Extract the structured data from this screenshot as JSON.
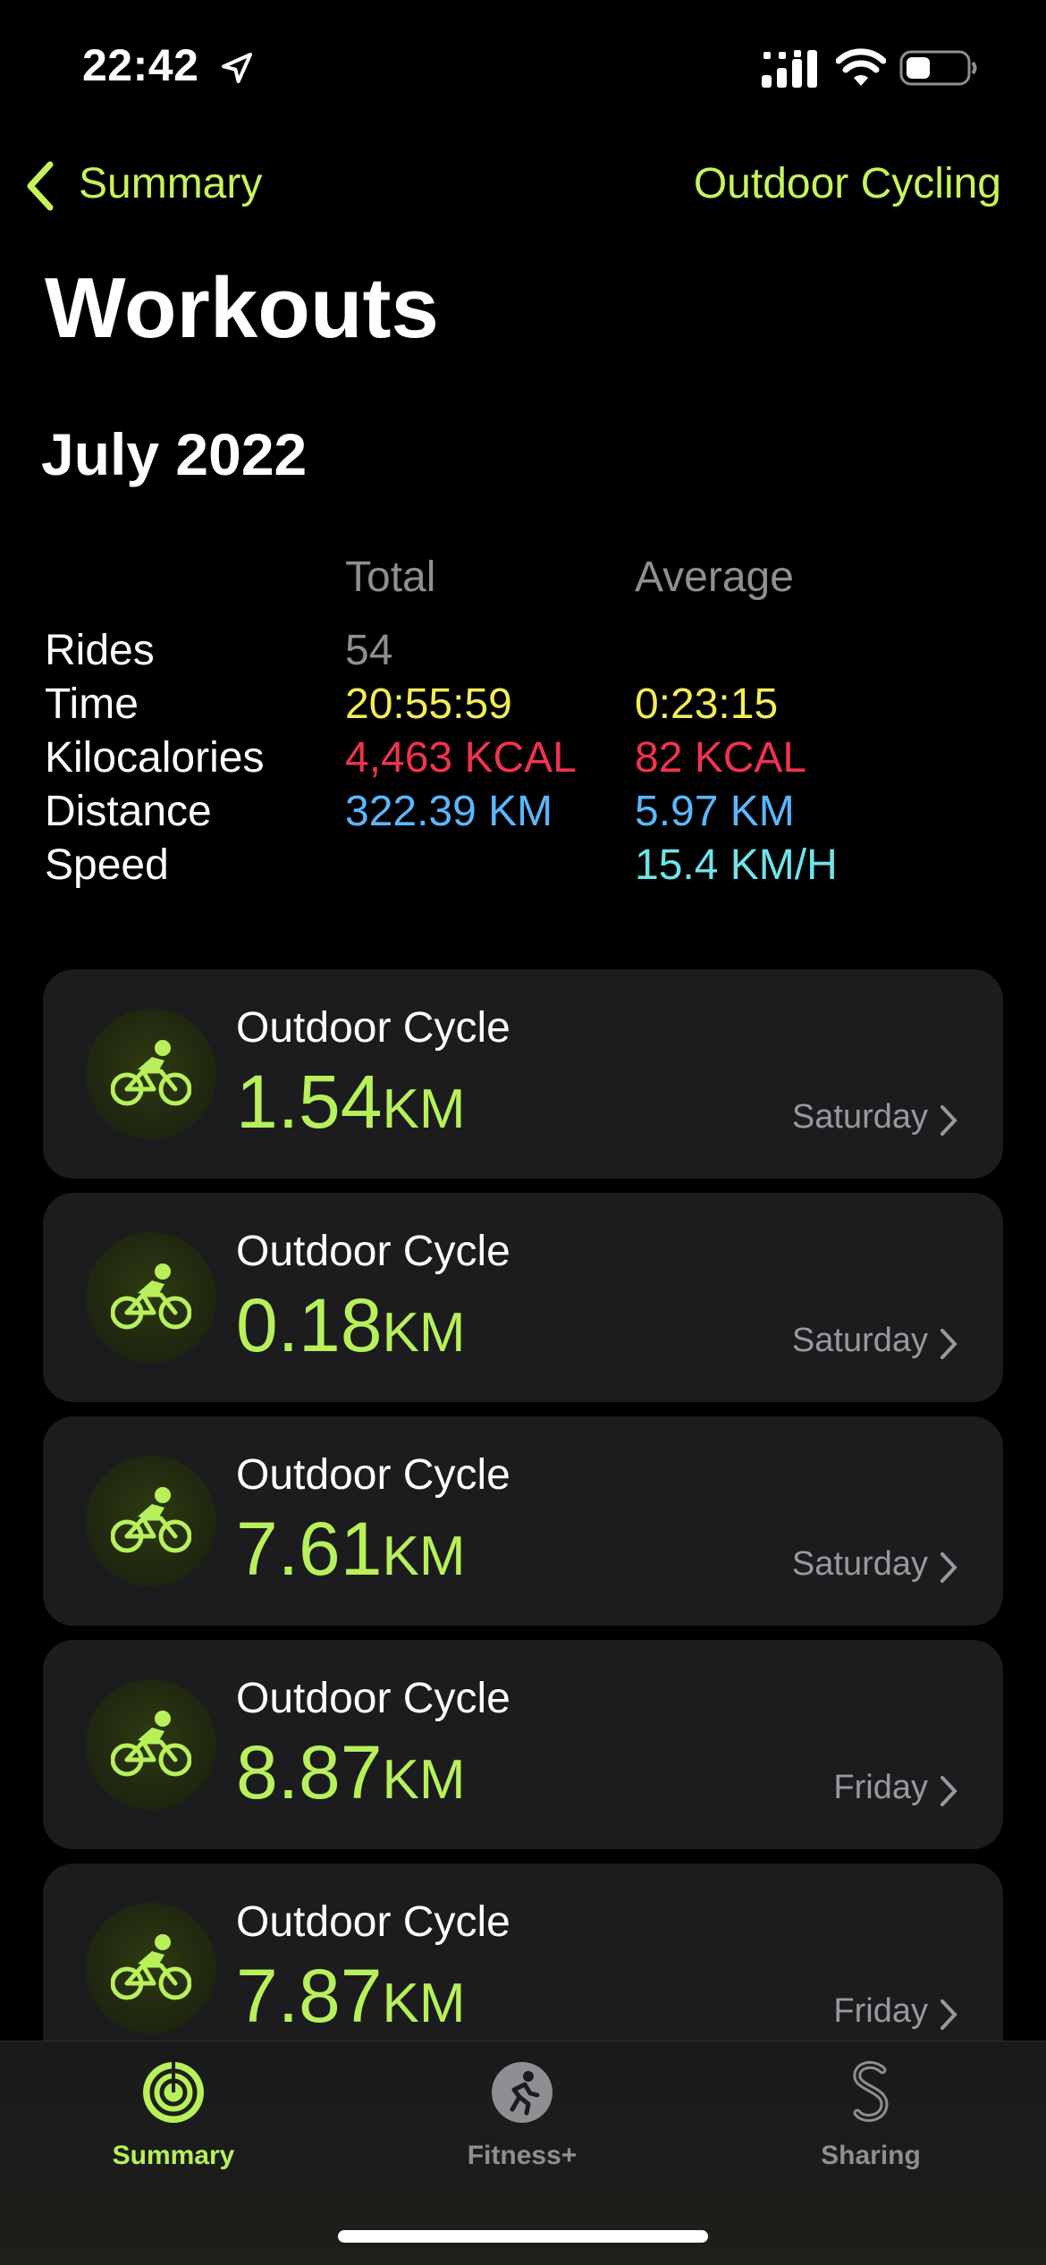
{
  "status": {
    "time": "22:42"
  },
  "nav": {
    "back_label": "Summary",
    "filter_label": "Outdoor Cycling"
  },
  "page": {
    "title": "Workouts",
    "month": "July 2022"
  },
  "summary": {
    "col_total": "Total",
    "col_average": "Average",
    "rows": [
      {
        "label": "Rides",
        "total": "54",
        "average": ""
      },
      {
        "label": "Time",
        "total": "20:55:59",
        "average": "0:23:15"
      },
      {
        "label": "Kilocalories",
        "total": "4,463 KCAL",
        "average": "82 KCAL"
      },
      {
        "label": "Distance",
        "total": "322.39 KM",
        "average": "5.97 KM"
      },
      {
        "label": "Speed",
        "total": "",
        "average": "15.4 KM/H"
      }
    ]
  },
  "workouts": [
    {
      "type": "Outdoor Cycle",
      "value": "1.54",
      "unit": "KM",
      "day": "Saturday",
      "icon": "cycling-icon"
    },
    {
      "type": "Outdoor Cycle",
      "value": "0.18",
      "unit": "KM",
      "day": "Saturday",
      "icon": "cycling-icon"
    },
    {
      "type": "Outdoor Cycle",
      "value": "7.61",
      "unit": "KM",
      "day": "Saturday",
      "icon": "cycling-icon"
    },
    {
      "type": "Outdoor Cycle",
      "value": "8.87",
      "unit": "KM",
      "day": "Friday",
      "icon": "cycling-icon"
    },
    {
      "type": "Outdoor Cycle",
      "value": "7.87",
      "unit": "KM",
      "day": "Friday",
      "icon": "cycling-icon"
    }
  ],
  "tabs": [
    {
      "label": "Summary",
      "icon": "activity-rings-icon",
      "active": true
    },
    {
      "label": "Fitness+",
      "icon": "fitness-plus-icon",
      "active": false
    },
    {
      "label": "Sharing",
      "icon": "sharing-icon",
      "active": false
    }
  ],
  "colors": {
    "accent": "#c5f45a",
    "time": "#f3ee55",
    "kcal": "#f0334f",
    "distance": "#5bb7ff",
    "speed": "#6fe4ea"
  }
}
